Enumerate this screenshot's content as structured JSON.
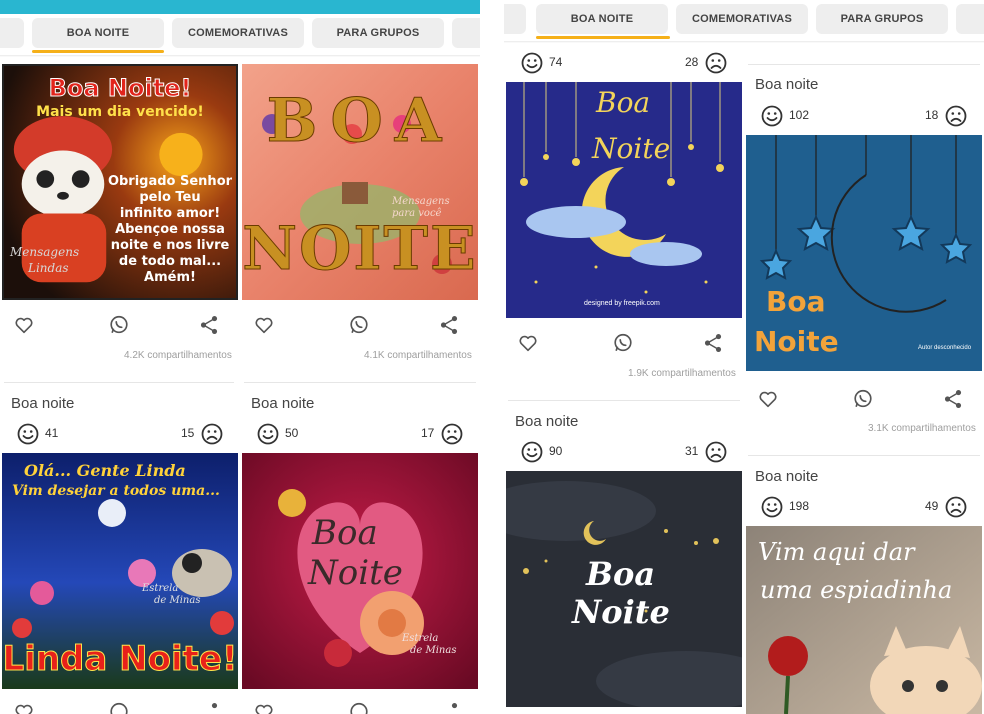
{
  "colors": {
    "topbar": "#29b6d0",
    "accent": "#f5b019",
    "tab_bg": "#eeeeee",
    "icon": "#555555"
  },
  "left": {
    "tabs": [
      {
        "label": ""
      },
      {
        "label": "BOA NOITE",
        "active": true
      },
      {
        "label": "COMEMORATIVAS"
      },
      {
        "label": "PARA GRUPOS"
      },
      {
        "label": ""
      }
    ],
    "cards": [
      {
        "image": {
          "title": "Boa Noite!",
          "subtitle": "Mais um dia vencido!",
          "lines": [
            "Obrigado Senhor",
            "pelo Teu",
            "infinito amor!",
            "Abençoe nossa",
            "noite e nos livre",
            "de todo mal...",
            "Amém!"
          ],
          "watermark": [
            "Mensagens",
            "Lindas"
          ]
        },
        "shares": "4.2K compartilhamentos"
      },
      {
        "image": {
          "title_top": "BOA",
          "title_bottom": "NOITE",
          "watermark": [
            "Mensagens",
            "para você"
          ]
        },
        "shares": "4.1K compartilhamentos"
      },
      {
        "title": "Boa noite",
        "likes": "41",
        "dislikes": "15",
        "image": {
          "line1": "Olá... Gente Linda",
          "line2": "Vim desejar a todos uma...",
          "bottom": "Linda Noite!",
          "watermark": [
            "Estrela",
            "de Minas"
          ]
        }
      },
      {
        "title": "Boa noite",
        "likes": "50",
        "dislikes": "17",
        "image": {
          "line1": "Boa",
          "line2": "Noite",
          "watermark": [
            "Estrela",
            "de Minas"
          ]
        }
      }
    ]
  },
  "right": {
    "tabs": [
      {
        "label": ""
      },
      {
        "label": "BOA NOITE",
        "active": true
      },
      {
        "label": "COMEMORATIVAS"
      },
      {
        "label": "PARA GRUPOS"
      },
      {
        "label": ""
      }
    ],
    "cards": [
      {
        "likes": "74",
        "dislikes": "28",
        "image": {
          "line1": "Boa",
          "line2": "Noite",
          "credit": "designed by freepik.com"
        },
        "shares": "1.9K compartilhamentos"
      },
      {
        "title": "Boa noite",
        "likes": "102",
        "dislikes": "18",
        "image": {
          "line1": "Boa",
          "line2": "Noite",
          "credit": "Autor desconhecido"
        },
        "shares": "3.1K compartilhamentos"
      },
      {
        "title": "Boa noite",
        "likes": "90",
        "dislikes": "31",
        "image": {
          "line1": "Boa",
          "line2": "Noite"
        }
      },
      {
        "title": "Boa noite",
        "likes": "198",
        "dislikes": "49",
        "image": {
          "line1": "Vim aqui dar",
          "line2": "uma espiadinha"
        }
      }
    ]
  }
}
